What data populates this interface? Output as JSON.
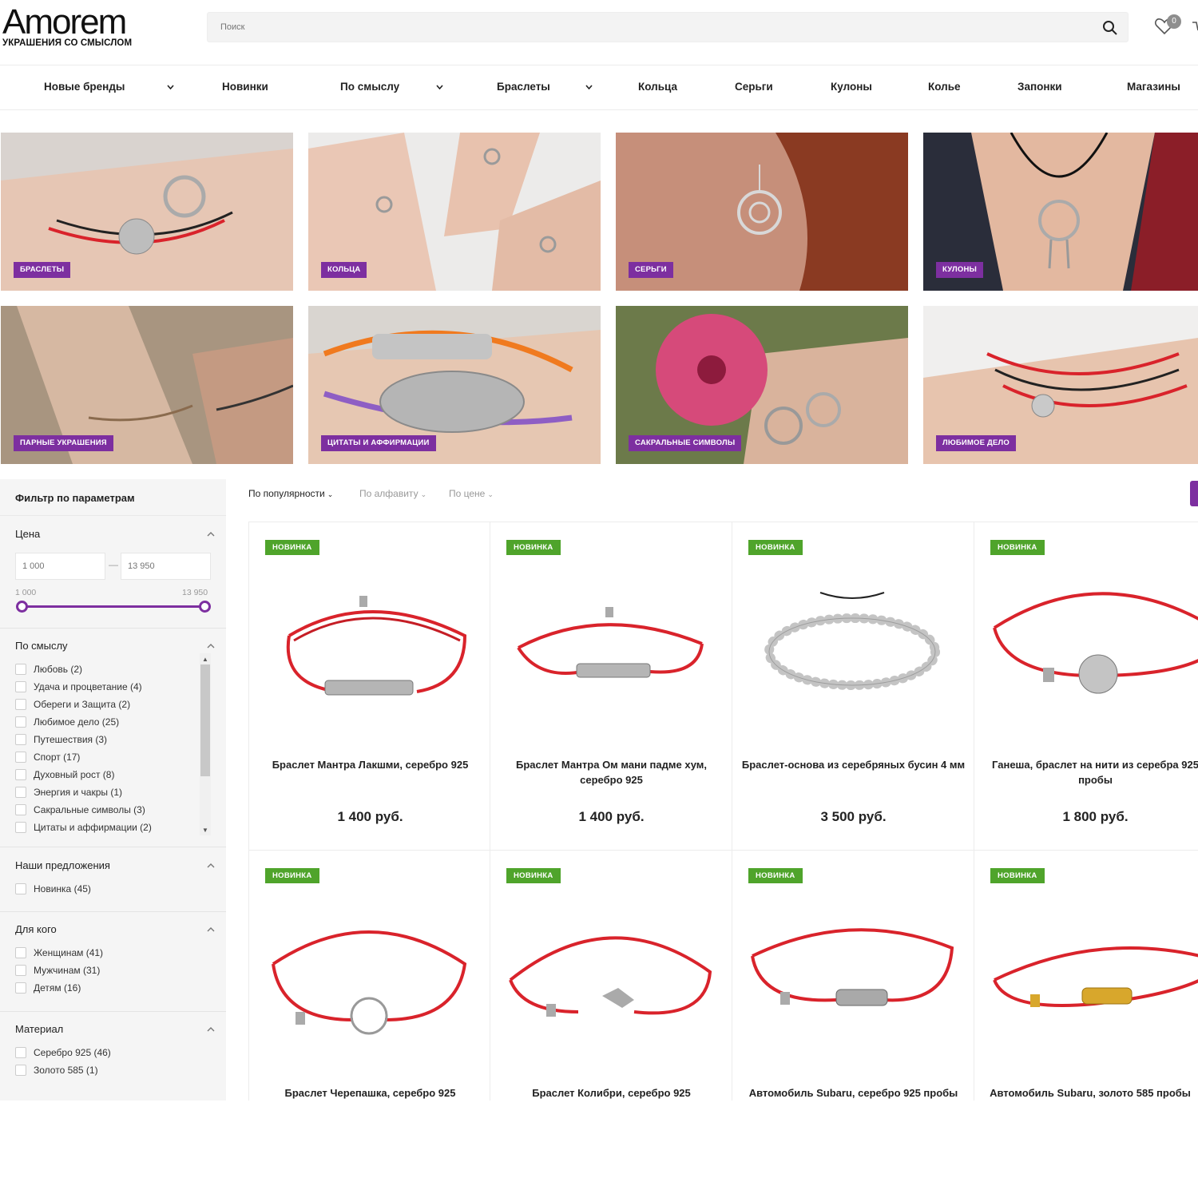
{
  "header": {
    "logo_title": "Amorem",
    "logo_subtitle": "УКРАШЕНИЯ СО СМЫСЛОМ",
    "search_placeholder": "Поиск",
    "wishlist_count": "0"
  },
  "nav": {
    "items": [
      "Новые бренды",
      "Новинки",
      "По смыслу",
      "Браслеты",
      "Кольца",
      "Серьги",
      "Кулоны",
      "Колье",
      "Запонки",
      "Магазины"
    ]
  },
  "categories": [
    {
      "label": "Браслеты"
    },
    {
      "label": "Кольца"
    },
    {
      "label": "Серьги"
    },
    {
      "label": "Кулоны"
    },
    {
      "label": "Парные украшения"
    },
    {
      "label": "Цитаты и аффирмации"
    },
    {
      "label": "Сакральные символы"
    },
    {
      "label": "Любимое дело"
    }
  ],
  "filter": {
    "title": "Фильтр по параметрам",
    "price": {
      "title": "Цена",
      "min_placeholder": "1 000",
      "max_placeholder": "13 950",
      "range_min": "1 000",
      "range_max": "13 950"
    },
    "meaning": {
      "title": "По смыслу",
      "options": [
        "Любовь (2)",
        "Удача и процветание (4)",
        "Обереги и Защита (2)",
        "Любимое дело (25)",
        "Путешествия (3)",
        "Спорт (17)",
        "Духовный рост (8)",
        "Энергия и чакры (1)",
        "Сакральные символы (3)",
        "Цитаты и аффирмации (2)"
      ]
    },
    "offers": {
      "title": "Наши предложения",
      "options": [
        "Новинка (45)"
      ]
    },
    "for_whom": {
      "title": "Для кого",
      "options": [
        "Женщинам (41)",
        "Мужчинам (31)",
        "Детям (16)"
      ]
    },
    "material": {
      "title": "Материал",
      "options": [
        "Серебро 925 (46)",
        "Золото 585 (1)"
      ]
    }
  },
  "sort": {
    "popularity": "По популярности",
    "alphabet": "По алфавиту",
    "price": "По цене"
  },
  "products": [
    {
      "badge": "Новинка",
      "name": "Браслет Мантра Лакшми, серебро 925",
      "price": "1 400 руб."
    },
    {
      "badge": "Новинка",
      "name": "Браслет Мантра Ом мани падме хум, серебро 925",
      "price": "1 400 руб."
    },
    {
      "badge": "Новинка",
      "name": "Браслет-основа из серебряных бусин 4 мм",
      "price": "3 500 руб."
    },
    {
      "badge": "Новинка",
      "name": "Ганеша, браслет на нити из серебра 925 пробы",
      "price": "1 800 руб."
    },
    {
      "badge": "Новинка",
      "name": "Браслет Черепашка, серебро 925",
      "price": ""
    },
    {
      "badge": "Новинка",
      "name": "Браслет Колибри, серебро 925",
      "price": ""
    },
    {
      "badge": "Новинка",
      "name": "Автомобиль Subaru, серебро 925 пробы",
      "price": ""
    },
    {
      "badge": "Новинка",
      "name": "Автомобиль Subaru, золото 585 пробы",
      "price": ""
    }
  ],
  "colors": {
    "accent": "#7d2fa0",
    "new_badge": "#4fa42b",
    "cord": "#d9232b",
    "silver": "#a9a9a9"
  }
}
